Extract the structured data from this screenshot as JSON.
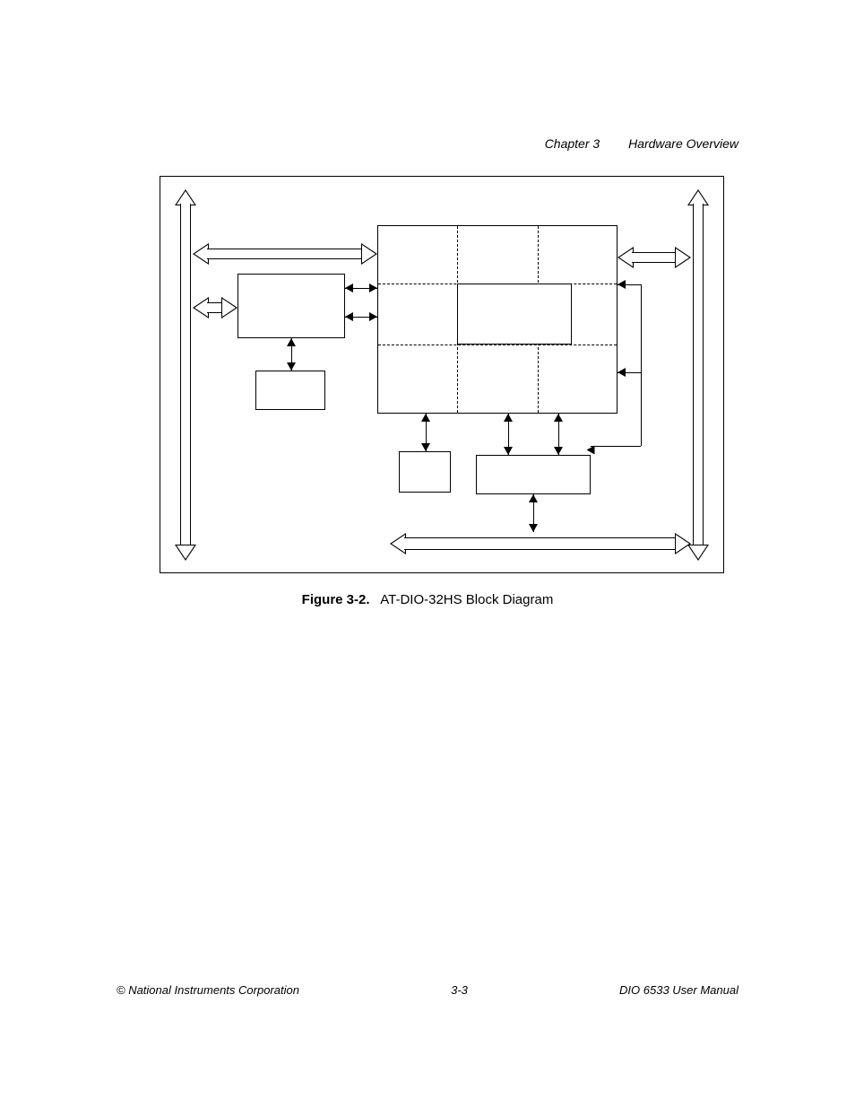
{
  "header": {
    "chapter": "Chapter 3",
    "title": "Hardware Overview"
  },
  "figure": {
    "label": "Figure 3-2.",
    "caption": "AT-DIO-32HS Block Diagram"
  },
  "footer": {
    "copyright": "© National Instruments Corporation",
    "page": "3-3",
    "manual": "DIO 6533 User Manual"
  }
}
